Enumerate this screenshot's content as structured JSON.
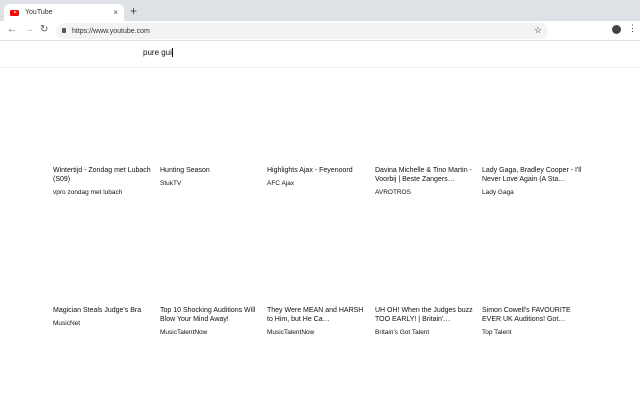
{
  "browser": {
    "tab_title": "YouTube",
    "url": "https://www.youtube.com",
    "new_tab": "+",
    "close": "×"
  },
  "search": {
    "value": "pure gui"
  },
  "videos": [
    {
      "title": "Wintertijd - Zondag met Lubach (S09)",
      "channel": "vpro zondag met lubach"
    },
    {
      "title": "Hunting Season",
      "channel": "StukTV"
    },
    {
      "title": "Highlights Ajax - Feyenoord",
      "channel": "AFC Ajax"
    },
    {
      "title": "Davina Michelle & Tino Martin - Voorbij | Beste Zangers…",
      "channel": "AVROTROS"
    },
    {
      "title": "Lady Gaga, Bradley Cooper - I'll Never Love Again (A Sta…",
      "channel": "Lady Gaga"
    },
    {
      "title": "Magician Steals Judge's Bra",
      "channel": "MusicNet"
    },
    {
      "title": "Top 10 Shocking Auditions Will Blow Your Mind Away!",
      "channel": "MusicTalentNow"
    },
    {
      "title": "They Were MEAN and HARSH to Him, but He Ca…",
      "channel": "MusicTalentNow"
    },
    {
      "title": "UH OH! When the Judges buzz TOO EARLY! | Britain'…",
      "channel": "Britain's Got Talent"
    },
    {
      "title": "Simon Cowell's FAVOURITE EVER UK Auditions! Got…",
      "channel": "Top Talent"
    }
  ]
}
